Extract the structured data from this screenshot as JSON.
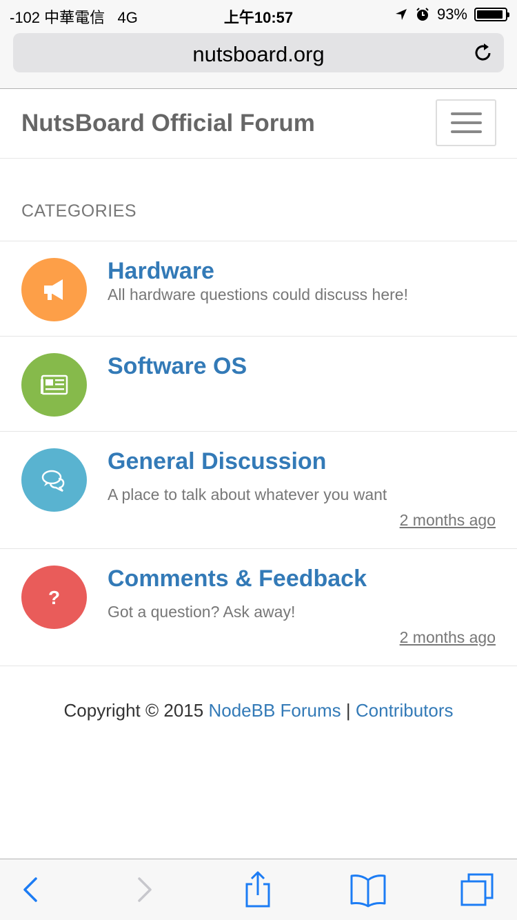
{
  "status_bar": {
    "carrier": "-102 中華電信",
    "network": "4G",
    "time": "上午10:57",
    "battery_percent": "93%",
    "battery_level": 0.93
  },
  "browser": {
    "url": "nutsboard.org",
    "icons": {
      "reload": "reload-icon",
      "back": "back-icon",
      "forward": "forward-icon",
      "share": "share-icon",
      "bookmarks": "bookmarks-icon",
      "tabs": "tabs-icon"
    }
  },
  "header": {
    "brand": "NutsBoard Official Forum",
    "menu_icon": "hamburger-menu-icon"
  },
  "categories_heading": "CATEGORIES",
  "categories": [
    {
      "title": "Hardware",
      "description": "All hardware questions could discuss here!",
      "last_post": "",
      "color": "#fd9f48",
      "icon": "bullhorn-icon"
    },
    {
      "title": "Software OS",
      "description": "",
      "last_post": "",
      "color": "#86ba4b",
      "icon": "newspaper-icon"
    },
    {
      "title": "General Discussion",
      "description": "A place to talk about whatever you want",
      "last_post": "2 months ago",
      "color": "#59b3d0",
      "icon": "comments-icon"
    },
    {
      "title": "Comments & Feedback",
      "description": "Got a question? Ask away!",
      "last_post": "2 months ago",
      "color": "#e95c5a",
      "icon": "question-icon"
    }
  ],
  "footer": {
    "prefix": "Copyright © 2015",
    "link1": "NodeBB Forums",
    "separator": "|",
    "link2": "Contributors"
  },
  "colors": {
    "link": "#337ab7",
    "ios_blue": "#1c7cf4"
  }
}
